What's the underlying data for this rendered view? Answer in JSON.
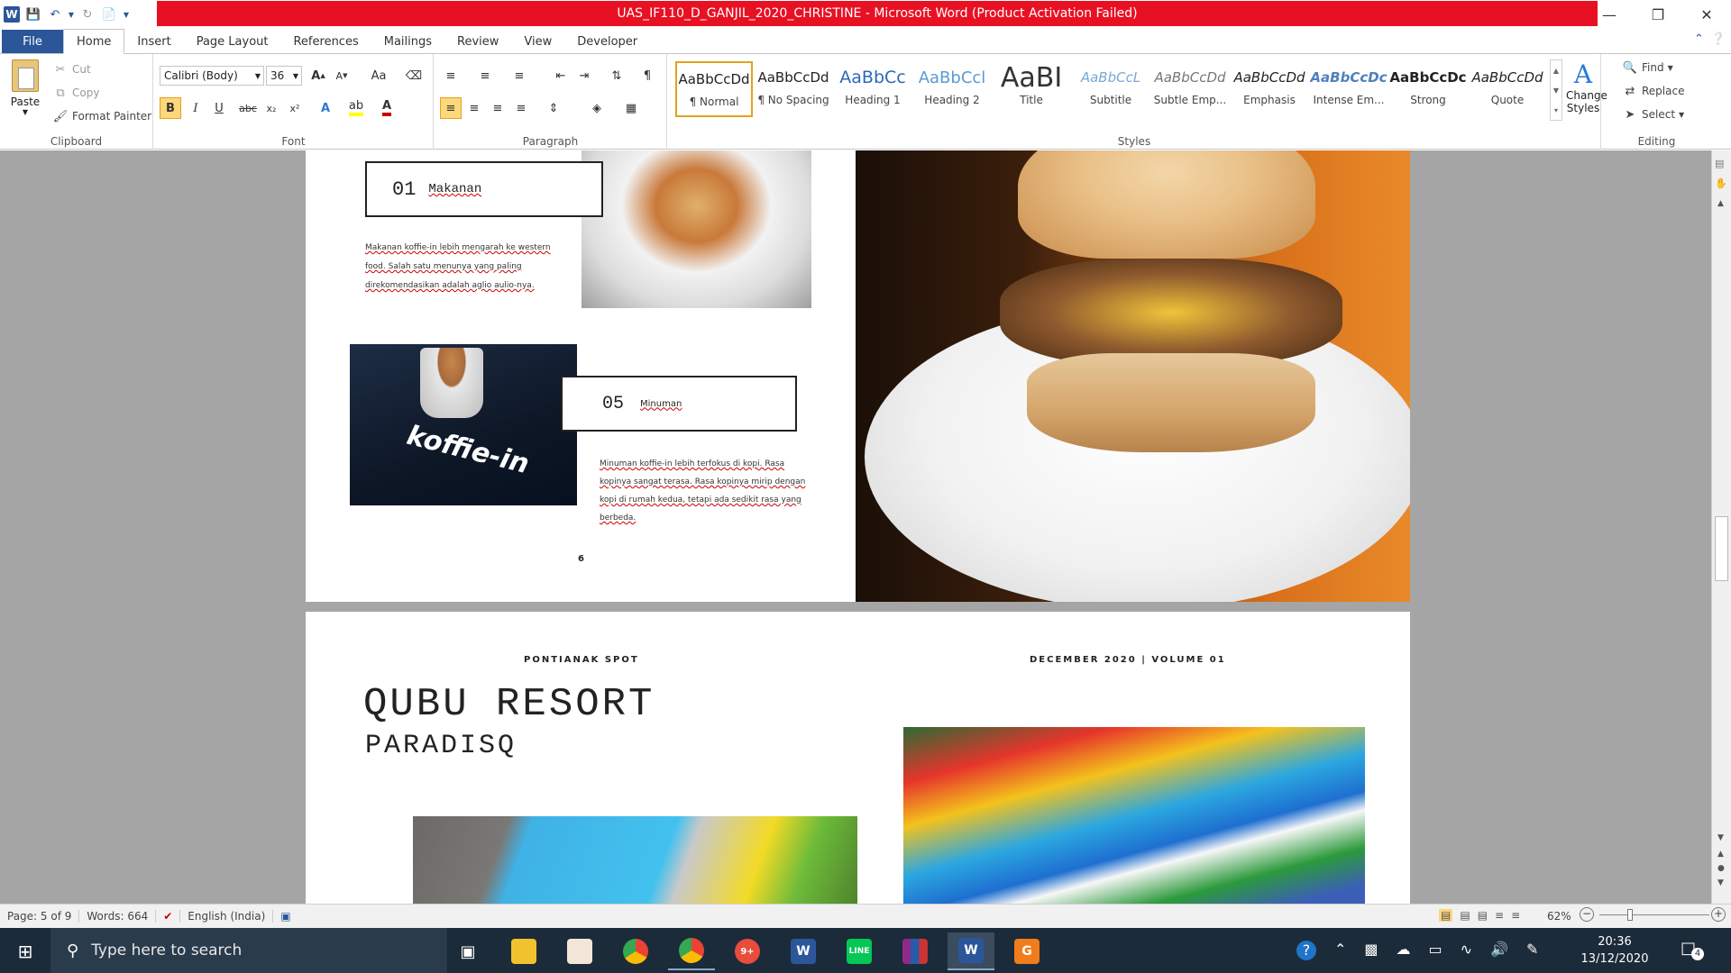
{
  "window": {
    "title": "UAS_IF110_D_GANJIL_2020_CHRISTINE  -  Microsoft Word (Product Activation Failed)",
    "title_bar_color": "#e81123"
  },
  "tabs": [
    "File",
    "Home",
    "Insert",
    "Page Layout",
    "References",
    "Mailings",
    "Review",
    "View",
    "Developer"
  ],
  "active_tab": "Home",
  "clipboard": {
    "paste": "Paste",
    "cut": "Cut",
    "copy": "Copy",
    "format_painter": "Format Painter",
    "label": "Clipboard"
  },
  "font": {
    "name": "Calibri (Body)",
    "size": "36",
    "label": "Font",
    "grow": "A",
    "shrink": "A",
    "change_case": "Aa"
  },
  "paragraph": {
    "label": "Paragraph"
  },
  "styles": {
    "label": "Styles",
    "items": [
      {
        "preview": "AaBbCcDd",
        "name": "¶ Normal"
      },
      {
        "preview": "AaBbCcDd",
        "name": "¶ No Spacing"
      },
      {
        "preview": "AaBbCc",
        "name": "Heading 1"
      },
      {
        "preview": "AaBbCcl",
        "name": "Heading 2"
      },
      {
        "preview": "AaBI",
        "name": "Title"
      },
      {
        "preview": "AaBbCcL",
        "name": "Subtitle"
      },
      {
        "preview": "AaBbCcDd",
        "name": "Subtle Emp..."
      },
      {
        "preview": "AaBbCcDd",
        "name": "Emphasis"
      },
      {
        "preview": "AaBbCcDc",
        "name": "Intense Em..."
      },
      {
        "preview": "AaBbCcDc",
        "name": "Strong"
      },
      {
        "preview": "AaBbCcDd",
        "name": "Quote"
      }
    ],
    "change_styles": "Change Styles"
  },
  "editing": {
    "label": "Editing",
    "find": "Find",
    "replace": "Replace",
    "select": "Select"
  },
  "page1": {
    "item1": {
      "number": "01",
      "title": "Makanan",
      "text": "Makanan koffie-in lebih mengarah  ke western food. Salah satu menunya yang paling direkomendasikan  adalah aglio aulio-nya."
    },
    "item2": {
      "number": "05",
      "title": "Minuman",
      "text": "Minuman koffie-in lebih terfokus di kopi. Rasa kopinya sangat terasa.  Rasa kopinya mirip dengan kopi di rumah  kedua,  tetapi ada sedikit rasa yang berbeda."
    },
    "coffee_label": "koffie-in",
    "page_number": "6"
  },
  "page2": {
    "header_left": "PONTIANAK  SPOT",
    "header_right": "DECEMBER  2020  |  VOLUME  01",
    "title": "QUBU RESORT",
    "subtitle": "PARADISQ"
  },
  "status": {
    "page": "Page: 5 of 9",
    "words": "Words: 664",
    "language": "English (India)",
    "zoom": "62%"
  },
  "taskbar": {
    "search_placeholder": "Type here to search",
    "time": "20:36",
    "date": "13/12/2020",
    "notification_count": "4",
    "chrome_badge": "9+"
  }
}
